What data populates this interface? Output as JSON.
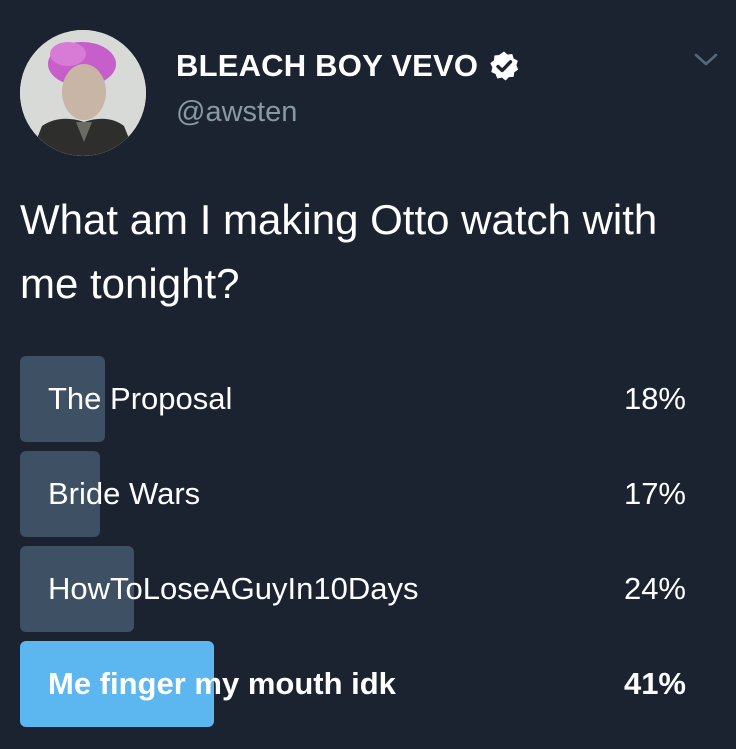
{
  "tweet": {
    "display_name": "BLEACH BOY VEVO",
    "handle": "@awsten",
    "verified": true,
    "text": "What am I making Otto watch with me tonight?"
  },
  "icons": {
    "avatar": "profile-photo",
    "verified": "verified-badge-icon",
    "caret": "chevron-down-icon"
  },
  "poll": {
    "options": [
      {
        "label": "The Proposal",
        "percent_text": "18%",
        "percent": 18,
        "winner": false
      },
      {
        "label": "Bride Wars",
        "percent_text": "17%",
        "percent": 17,
        "winner": false
      },
      {
        "label": "HowToLoseAGuyIn10Days",
        "percent_text": "24%",
        "percent": 24,
        "winner": false
      },
      {
        "label": "Me finger my mouth idk",
        "percent_text": "41%",
        "percent": 41,
        "winner": true
      }
    ]
  },
  "colors": {
    "background": "#1b2330",
    "bar": "#3e5064",
    "winner_bar": "#5cb6f0",
    "handle": "#8899a6"
  }
}
